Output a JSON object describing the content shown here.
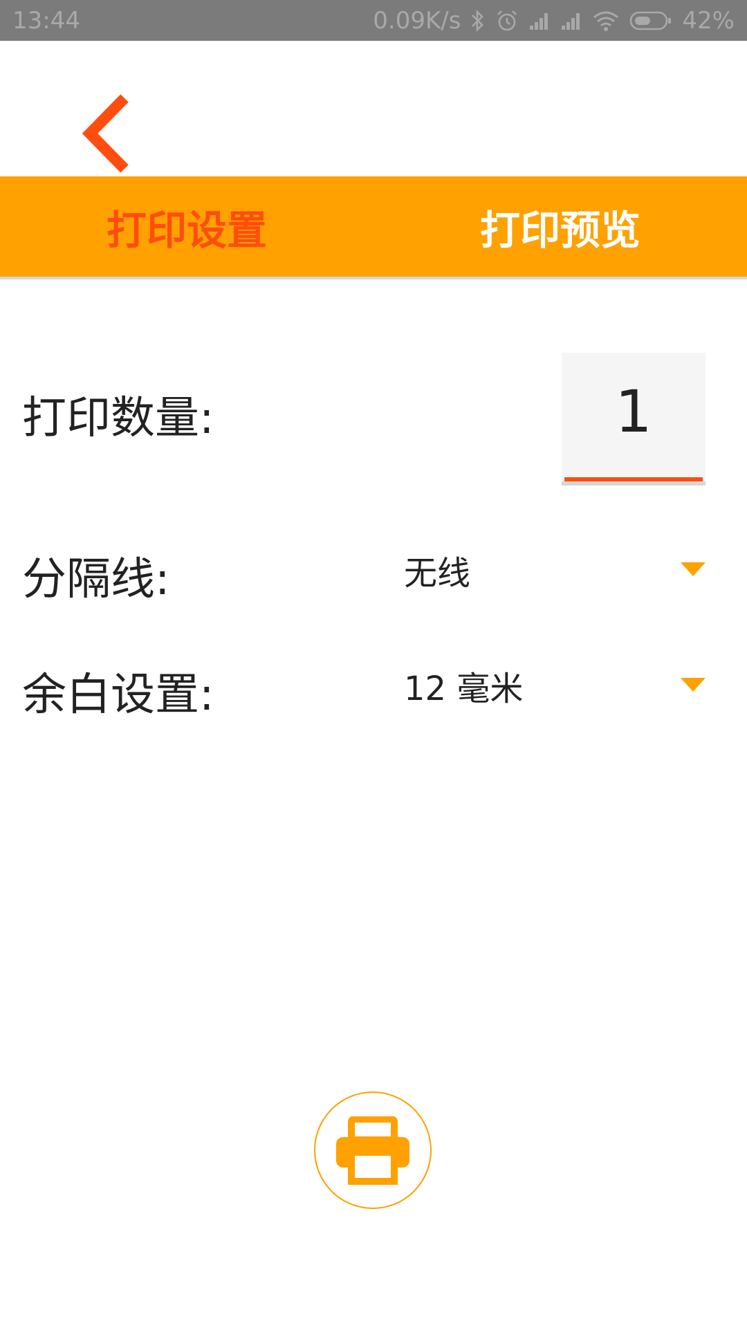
{
  "status_bar": {
    "time": "13:44",
    "network_speed": "0.09K/s",
    "battery": "42%",
    "icons": [
      "bluetooth-icon",
      "alarm-icon",
      "signal-icon",
      "signal-icon",
      "wifi-icon",
      "battery-icon"
    ]
  },
  "nav": {
    "back_icon": "chevron-left-icon"
  },
  "tabs": [
    {
      "label": "打印设置",
      "active": true
    },
    {
      "label": "打印预览",
      "active": false
    }
  ],
  "settings": {
    "quantity": {
      "label": "打印数量:",
      "value": "1"
    },
    "separator": {
      "label": "分隔线:",
      "value": "无线"
    },
    "margin": {
      "label": "余白设置:",
      "value": "12 毫米"
    }
  },
  "print_button": {
    "icon": "printer-icon"
  },
  "colors": {
    "accent": "#fea101",
    "active": "#ff4d0f",
    "status_bar": "#7b7b7b"
  }
}
